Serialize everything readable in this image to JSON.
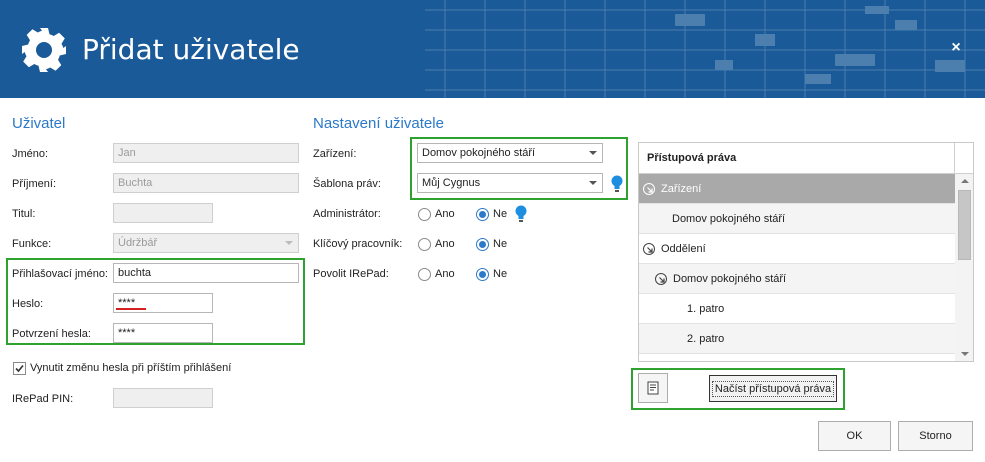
{
  "header": {
    "title": "Přidat uživatele",
    "close_label": "×",
    "color": "#1a5a98"
  },
  "user_section": {
    "title": "Uživatel",
    "fields": {
      "jmeno": {
        "label": "Jméno:",
        "value": "Jan"
      },
      "prijmeni": {
        "label": "Příjmení:",
        "value": "Buchta"
      },
      "titul": {
        "label": "Titul:",
        "value": ""
      },
      "funkce": {
        "label": "Funkce:",
        "value": "Údržbář"
      },
      "login": {
        "label": "Přihlašovací jméno:",
        "value": "buchta"
      },
      "heslo": {
        "label": "Heslo:",
        "value": "****"
      },
      "potvrzeni": {
        "label": "Potvrzení hesla:",
        "value": "****"
      },
      "pin": {
        "label": "IRePad PIN:",
        "value": ""
      }
    },
    "force_change": {
      "label": "Vynutit změnu hesla při příštím přihlášení",
      "checked": true
    }
  },
  "settings_section": {
    "title": "Nastavení uživatele",
    "zarizeni": {
      "label": "Zařízení:",
      "value": "Domov pokojného stáří"
    },
    "sablona": {
      "label": "Šablona práv:",
      "value": "Můj Cygnus"
    },
    "administrator": {
      "label": "Administrátor:",
      "yes": "Ano",
      "no": "Ne",
      "selected": "no"
    },
    "klicovy": {
      "label": "Klíčový pracovník:",
      "yes": "Ano",
      "no": "Ne",
      "selected": "no"
    },
    "irepad": {
      "label": "Povolit IRePad:",
      "yes": "Ano",
      "no": "Ne",
      "selected": "no"
    }
  },
  "rights_grid": {
    "header": "Přístupová práva",
    "rows": [
      {
        "text": "Zařízení"
      },
      {
        "text": "Domov pokojného stáří"
      },
      {
        "text": "Oddělení"
      },
      {
        "text": "Domov pokojného stáří"
      },
      {
        "text": "1. patro"
      },
      {
        "text": "2. patro"
      }
    ]
  },
  "load_rights_button": "Načíst přístupová práva",
  "ok_button": "OK",
  "cancel_button": "Storno",
  "colors": {
    "accent": "#2b79c8",
    "highlight": "#2ea12e",
    "error": "#d62020"
  }
}
